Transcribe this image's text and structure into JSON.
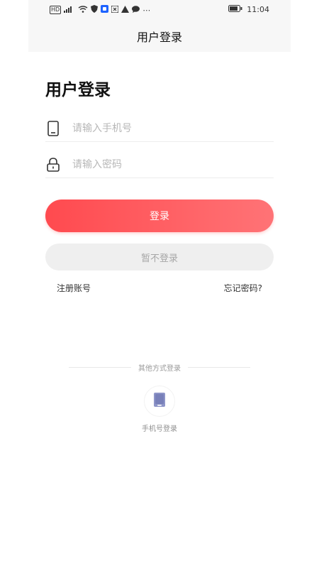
{
  "statusbar": {
    "left_icons": [
      "HD",
      "signal",
      "wifi",
      "shield",
      "vpn",
      "app",
      "alert",
      "chat",
      "more"
    ],
    "time": "11:04"
  },
  "header": {
    "title": "用户登录"
  },
  "login": {
    "heading": "用户登录",
    "phone_placeholder": "请输入手机号",
    "password_placeholder": "请输入密码",
    "login_button": "登录",
    "skip_button": "暂不登录",
    "register_link": "注册账号",
    "forgot_link": "忘记密码?"
  },
  "other_login": {
    "label": "其他方式登录",
    "phone_login_label": "手机号登录"
  },
  "colors": {
    "primary_start": "#ff4a4f",
    "primary_end": "#ff7376",
    "secondary_bg": "#efefef"
  }
}
